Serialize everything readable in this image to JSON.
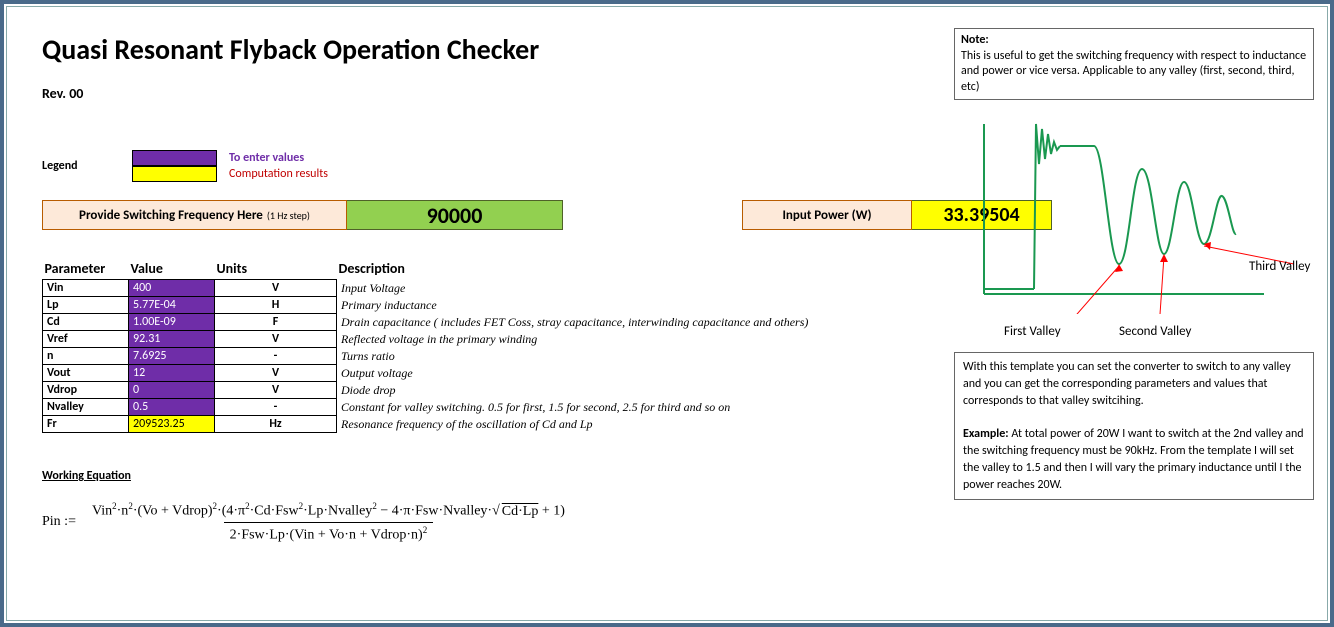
{
  "title": "Quasi Resonant Flyback Operation Checker",
  "revision": "Rev. 00",
  "legend": {
    "label": "Legend",
    "enter_text": "To enter values",
    "results_text": "Computation results"
  },
  "freq": {
    "label": "Provide Switching Frequency Here",
    "label_sub": "(1 Hz step)",
    "value": "90000"
  },
  "power": {
    "label": "Input Power (W)",
    "value": "33.39504"
  },
  "headers": {
    "param": "Parameter",
    "value": "Value",
    "units": "Units",
    "desc": "Description"
  },
  "rows": [
    {
      "param": "Vin",
      "value": "400",
      "units": "V",
      "desc": "Input Voltage",
      "type": "input"
    },
    {
      "param": "Lp",
      "value": "5.77E-04",
      "units": "H",
      "desc": "Primary inductance",
      "type": "input"
    },
    {
      "param": "Cd",
      "value": "1.00E-09",
      "units": "F",
      "desc": "Drain capacitance ( includes FET Coss, stray capacitance, interwinding capacitance and others)",
      "type": "input"
    },
    {
      "param": "Vref",
      "value": "92.31",
      "units": "V",
      "desc": "Reflected voltage in the primary winding",
      "type": "input"
    },
    {
      "param": "n",
      "value": "7.6925",
      "units": "-",
      "desc": "Turns ratio",
      "type": "input"
    },
    {
      "param": "Vout",
      "value": "12",
      "units": "V",
      "desc": "Output voltage",
      "type": "input"
    },
    {
      "param": "Vdrop",
      "value": "0",
      "units": "V",
      "desc": "Diode drop",
      "type": "input"
    },
    {
      "param": "Nvalley",
      "value": "0.5",
      "units": "-",
      "desc": "Constant for valley switching. 0.5 for first, 1.5 for second, 2.5 for third and so on",
      "type": "input"
    },
    {
      "param": "Fr",
      "value": "209523.25",
      "units": "Hz",
      "desc": "Resonance frequency of the oscillation of Cd and Lp",
      "type": "result"
    }
  ],
  "working_eq_label": "Working Equation",
  "note": {
    "title": "Note:",
    "body": "This is useful to get the switching frequency with respect to inductance and power or vice versa. Applicable to any valley (first, second, third, etc)"
  },
  "valleys": {
    "first": "First Valley",
    "second": "Second Valley",
    "third": "Third Valley"
  },
  "info": {
    "p1": "With this template you can set  the converter to switch to any valley and you can get the corresponding parameters and values that corresponds to that valley switcihing.",
    "ex_label": "Example:",
    "ex_body": " At total power of 20W I want to switch at the 2nd valley  and the switching frequency must be 90kHz.  From the template I will set the valley to 1.5 and then I will  vary the primary inductance until I the power reaches 20W."
  },
  "chart_data": {
    "type": "line",
    "title": "",
    "xlabel": "",
    "ylabel": "",
    "description": "Drain-source voltage waveform showing ringing after turn-off with three decaying valleys",
    "annotations": [
      "First Valley",
      "Second Valley",
      "Third Valley"
    ]
  }
}
